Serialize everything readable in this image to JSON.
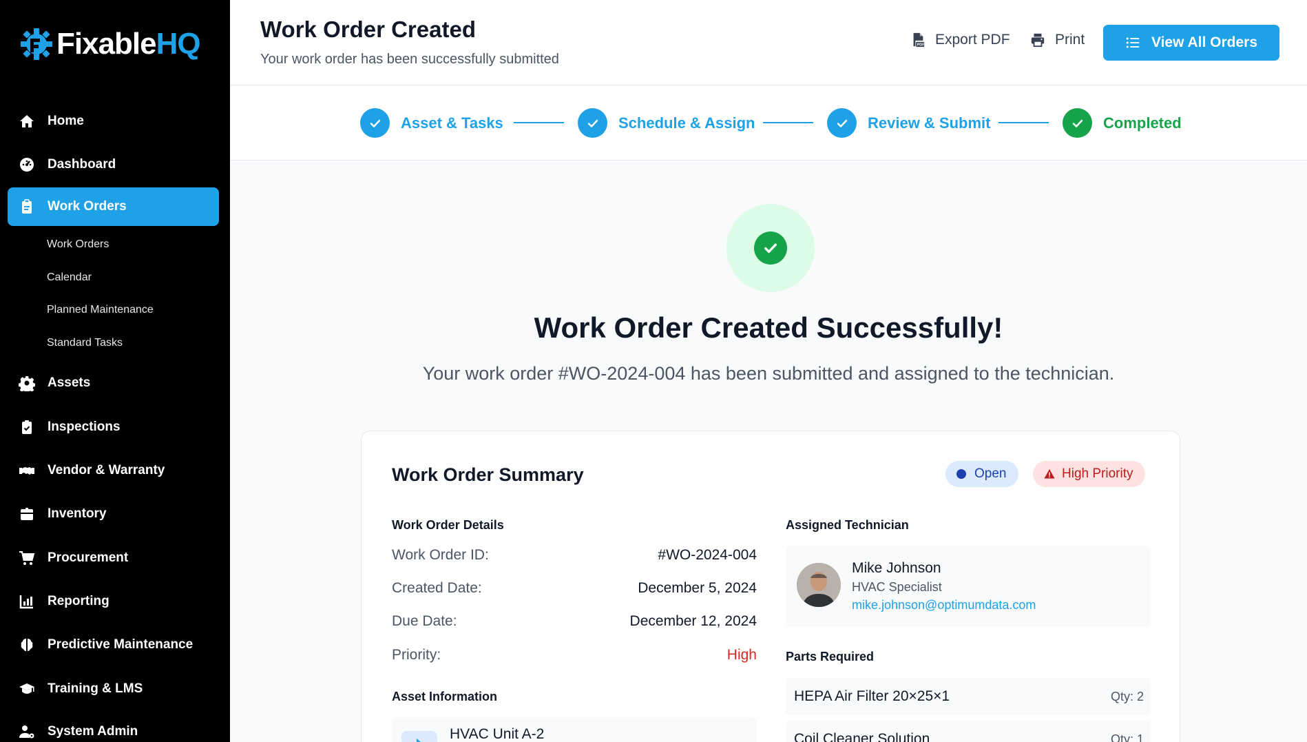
{
  "brand": {
    "name_part1": "Fixable",
    "name_part2": "HQ"
  },
  "sidebar": {
    "items": [
      {
        "label": "Home"
      },
      {
        "label": "Dashboard"
      },
      {
        "label": "Work Orders"
      },
      {
        "label": "Assets"
      },
      {
        "label": "Inspections"
      },
      {
        "label": "Vendor & Warranty"
      },
      {
        "label": "Inventory"
      },
      {
        "label": "Procurement"
      },
      {
        "label": "Reporting"
      },
      {
        "label": "Predictive Maintenance"
      },
      {
        "label": "Training & LMS"
      },
      {
        "label": "System Admin"
      }
    ],
    "sub_items": [
      {
        "label": "Work Orders"
      },
      {
        "label": "Calendar"
      },
      {
        "label": "Planned Maintenance"
      },
      {
        "label": "Standard Tasks"
      }
    ]
  },
  "header": {
    "title": "Work Order Created",
    "subtitle": "Your work order has been successfully submitted",
    "export_label": "Export PDF",
    "print_label": "Print",
    "view_all_label": "View All Orders"
  },
  "stepper": {
    "steps": [
      {
        "label": "Asset & Tasks",
        "state": "complete"
      },
      {
        "label": "Schedule & Assign",
        "state": "complete"
      },
      {
        "label": "Review & Submit",
        "state": "complete"
      },
      {
        "label": "Completed",
        "state": "done"
      }
    ]
  },
  "success": {
    "title": "Work Order Created Successfully!",
    "message": "Your work order #WO-2024-004 has been submitted and assigned to the technician."
  },
  "summary": {
    "title": "Work Order Summary",
    "status_badge": "Open",
    "priority_badge": "High Priority",
    "details_title": "Work Order Details",
    "details": [
      {
        "label": "Work Order ID:",
        "value": "#WO-2024-004"
      },
      {
        "label": "Created Date:",
        "value": "December 5, 2024"
      },
      {
        "label": "Due Date:",
        "value": "December 12, 2024"
      },
      {
        "label": "Priority:",
        "value": "High"
      }
    ],
    "asset_title": "Asset Information",
    "asset_name": "HVAC Unit A-2",
    "technician_title": "Assigned Technician",
    "technician": {
      "name": "Mike Johnson",
      "role": "HVAC Specialist",
      "email": "mike.johnson@optimumdata.com"
    },
    "parts_title": "Parts Required",
    "parts": [
      {
        "name": "HEPA Air Filter 20×25×1",
        "qty": "Qty: 2"
      },
      {
        "name": "Coil Cleaner Solution",
        "qty": "Qty: 1"
      }
    ]
  },
  "colors": {
    "accent": "#1ea1e6",
    "success": "#16a34a",
    "danger": "#dc2626"
  }
}
